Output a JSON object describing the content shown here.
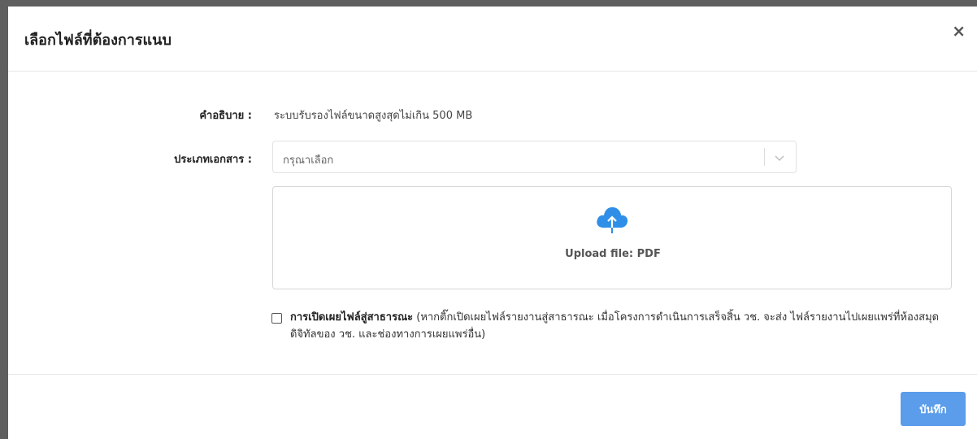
{
  "modal": {
    "title": "เลือกไฟล์ที่ต้องการแนบ",
    "close_glyph": "×"
  },
  "form": {
    "description_label": "คำอธิบาย :",
    "description_value": "ระบบรับรองไฟล์ขนาดสูงสุดไม่เกิน 500 MB",
    "doc_type_label": "ประเภทเอกสาร :",
    "doc_type_placeholder": "กรุณาเลือก"
  },
  "upload": {
    "icon": "cloud-upload-icon",
    "label": "Upload file: PDF"
  },
  "disclosure": {
    "checked": false,
    "title": "การเปิดเผยไฟล์สู่สาธารณะ",
    "detail": " (หากติ๊กเปิดเผยไฟล์รายงานสู่สาธารณะ เมื่อโครงการดำเนินการเสร็จสิ้น วช. จะส่ง ไฟล์รายงานไปเผยแพร่ที่ห้องสมุดดิจิทัลของ วช. และช่องทางการเผยแพร่อื่น)"
  },
  "footer": {
    "save_label": "บันทึก"
  },
  "colors": {
    "primary": "#5b9dea",
    "upload_icon": "#2f8fe8"
  }
}
